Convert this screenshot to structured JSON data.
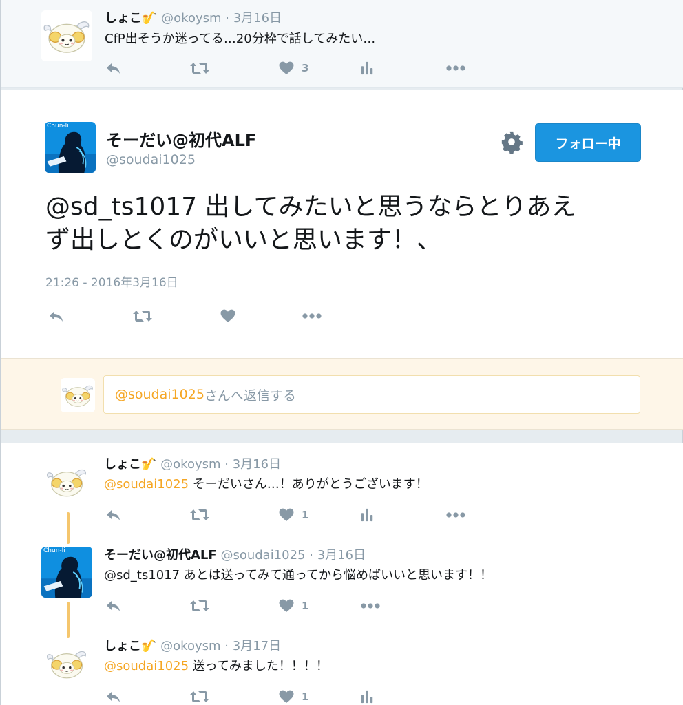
{
  "colors": {
    "accent": "#1b95e0",
    "mention": "#f5a623",
    "muted": "#8899a6"
  },
  "top_tweet": {
    "name": "しょこ",
    "emoji": "🎷",
    "handle": "@okoysm",
    "date": "3月16日",
    "text": "CfP出そうか迷ってる…20分枠で話してみたい…",
    "like_count": "3"
  },
  "main_tweet": {
    "name": "そーだい@初代ALF",
    "handle": "@soudai1025",
    "avatar_label": "Chun-li",
    "follow_label": "フォロー中",
    "text_line1": "@sd_ts1017 出してみたいと思うならとりあえ",
    "text_line2": "ず出しとくのがいいと思います！、",
    "timestamp": "21:26 - 2016年3月16日"
  },
  "reply_box": {
    "mention": "@soudai1025",
    "placeholder_rest": "さんへ返信する"
  },
  "replies": [
    {
      "name": "しょこ",
      "emoji": "🎷",
      "handle": "@okoysm",
      "date": "3月16日",
      "mention": "@soudai1025",
      "text": " そーだいさん…！ありがとうございます！",
      "like_count": "1"
    },
    {
      "name": "そーだい@初代ALF",
      "handle": "@soudai1025",
      "date": "3月16日",
      "avatar_label": "Chun-li",
      "text": "@sd_ts1017 あとは送ってみて通ってから悩めばいいと思います！！",
      "like_count": "1"
    },
    {
      "name": "しょこ",
      "emoji": "🎷",
      "handle": "@okoysm",
      "date": "3月17日",
      "mention": "@soudai1025",
      "text": " 送ってみました！！！！",
      "like_count": "1"
    }
  ]
}
